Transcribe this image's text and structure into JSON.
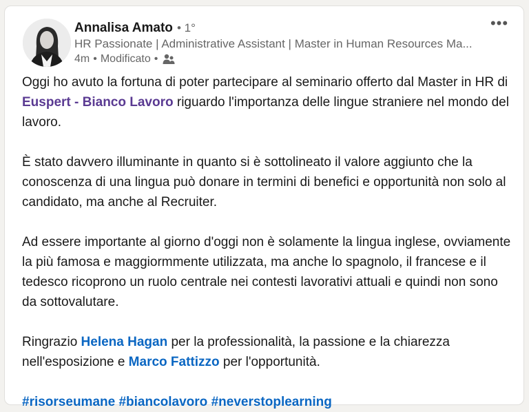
{
  "post": {
    "author": {
      "name": "Annalisa Amato",
      "degree": "• 1°",
      "headline": "HR Passionate | Administrative Assistant | Master in Human Resources Ma...",
      "time": "4m",
      "edited": "Modificato"
    },
    "more_icon": "more-horizontal-icon",
    "body": {
      "p1": {
        "before": "Oggi ho avuto la fortuna di poter partecipare al seminario offerto dal Master in HR di ",
        "mention": "Euspert - Bianco Lavoro",
        "after": " riguardo l'importanza delle lingue straniere nel mondo del lavoro."
      },
      "p2": "È stato davvero illuminante in quanto si è sottolineato il valore aggiunto che la conoscenza di una lingua può donare in termini di benefici e opportunità non solo al candidato, ma anche al Recruiter.",
      "p3": "Ad essere importante al giorno d'oggi non è solamente la lingua inglese, ovviamente la più famosa e maggiormmente utilizzata, ma anche lo spagnolo, il francese e il tedesco ricoprono un ruolo centrale nei contesti lavorativi attuali e quindi non sono da sottovalutare.",
      "p4": {
        "before": "Ringrazio ",
        "mention1": "Helena Hagan",
        "middle": " per la professionalità, la passione e la chiarezza nell'esposizione e ",
        "mention2": "Marco Fattizzo",
        "after": " per l'opportunità."
      },
      "hashtags": [
        "#risorseumane",
        "#biancolavoro",
        "#neverstoplearning"
      ]
    },
    "colors": {
      "link": "#0a66c2",
      "company_link": "#5a3a92",
      "text": "#191919",
      "muted": "#666666"
    }
  }
}
